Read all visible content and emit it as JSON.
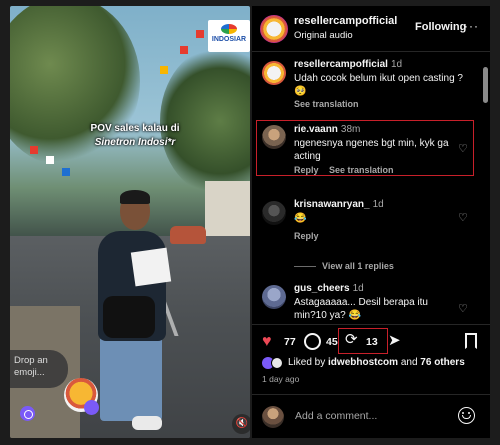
{
  "video": {
    "caption_line1": "POV sales kalau di",
    "caption_line2": "Sinetron Indosi*r",
    "channel_logo_text": "INDOSIAR",
    "drop_emoji_prompt": "Drop an emoji..."
  },
  "header": {
    "username": "resellercampofficial",
    "audio": "Original audio",
    "follow_label": "Following",
    "more_label": "···"
  },
  "comments": [
    {
      "user": "resellercampofficial",
      "time": "1d",
      "text": "Udah cocok belum ikut open casting ? 🥺",
      "see_translation": "See translation"
    },
    {
      "user": "rie.vaann",
      "time": "38m",
      "text": "ngenesnya ngenes bgt min, kyk ga acting",
      "reply": "Reply",
      "see_translation": "See translation"
    },
    {
      "user": "krisnawanryan_",
      "time": "1d",
      "text": "😂",
      "reply": "Reply",
      "view_replies": "View all 1 replies"
    },
    {
      "user": "gus_cheers",
      "time": "1d",
      "text": "Astagaaaaa... Desil berapa itu min?10 ya? 😂"
    }
  ],
  "actions": {
    "like_count": "77",
    "comment_count": "45",
    "repost_count": "13"
  },
  "likes": {
    "prefix": "Liked by",
    "user": "idwebhostcom",
    "conjunction": "and",
    "others": "76 others"
  },
  "posted_ago": "1 day ago",
  "add_comment": {
    "placeholder": "Add a comment..."
  },
  "colors": {
    "background": "#000000",
    "heart_red": "#ed4956",
    "highlight_red": "#c8202a",
    "muted_text": "#a8a8a8"
  }
}
